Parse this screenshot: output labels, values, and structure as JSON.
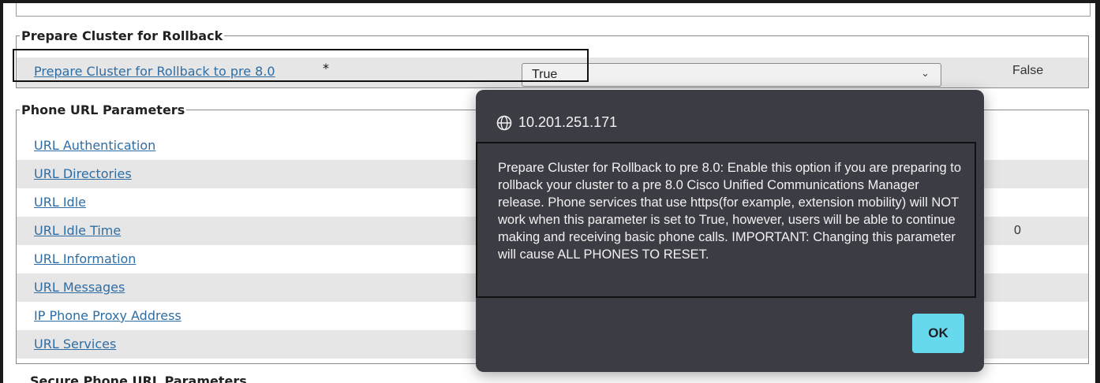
{
  "rollback_section": {
    "legend": "Prepare Cluster for Rollback",
    "param_label": "Prepare Cluster for Rollback to pre 8.0",
    "required_marker": "*",
    "select_value": "True",
    "default_value": "False"
  },
  "phone_url_section": {
    "legend": "Phone URL Parameters",
    "items": [
      {
        "label": "URL Authentication",
        "default": ""
      },
      {
        "label": "URL Directories",
        "default": ""
      },
      {
        "label": "URL Idle",
        "default": ""
      },
      {
        "label": "URL Idle Time",
        "default": "0"
      },
      {
        "label": "URL Information",
        "default": ""
      },
      {
        "label": "URL Messages",
        "default": ""
      },
      {
        "label": "IP Phone Proxy Address",
        "default": ""
      },
      {
        "label": "URL Services",
        "default": ""
      }
    ]
  },
  "next_section": {
    "legend": "Secure Phone URL Parameters"
  },
  "dialog": {
    "origin": "10.201.251.171",
    "message": "Prepare Cluster for Rollback to pre 8.0: Enable this option if you are preparing to rollback your cluster to a pre 8.0 Cisco Unified Communications Manager release. Phone services that use https(for example, extension mobility) will NOT work when this parameter is set to True, however, users will be able to continue making and receiving basic phone calls. IMPORTANT: Changing this parameter will cause ALL PHONES TO RESET.",
    "ok_label": "OK",
    "globe_icon": "globe-icon"
  },
  "colors": {
    "link": "#2e6da4",
    "dialog_bg": "#3c3c44",
    "ok_button": "#66d9ec",
    "row_shade": "#e6e6e6"
  }
}
